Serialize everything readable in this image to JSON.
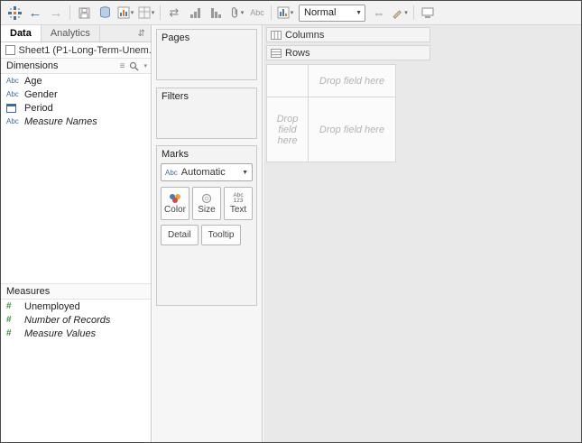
{
  "colors": {
    "dimension_blue": "#3d6a9e",
    "measure_green": "#3f8e3f",
    "accent_orange": "#e8762c",
    "toolbar_bg": "#f2f2f2",
    "canvas_bg": "#e9e9e9"
  },
  "icons": {
    "undo": "←",
    "redo": "→",
    "dropdown": "▾",
    "select_caret": "▼",
    "abc": "Abc",
    "numbers": "123",
    "hash": "#",
    "list": "≡",
    "pane_toggle": "⇵",
    "swap_axes": "⇄",
    "fit_width": "⇔"
  },
  "toolbar": {
    "fit_mode": "Normal"
  },
  "data_pane": {
    "tabs": [
      {
        "label": "Data"
      },
      {
        "label": "Analytics"
      }
    ],
    "data_source": "Sheet1 (P1-Long-Term-Unem...",
    "dimensions": {
      "header": "Dimensions",
      "items": [
        {
          "type": "string",
          "label": "Age",
          "italic": false
        },
        {
          "type": "string",
          "label": "Gender",
          "italic": false
        },
        {
          "type": "date",
          "label": "Period",
          "italic": false
        },
        {
          "type": "string",
          "label": "Measure Names",
          "italic": true
        }
      ]
    },
    "measures": {
      "header": "Measures",
      "items": [
        {
          "type": "number",
          "label": "Unemployed",
          "italic": false
        },
        {
          "type": "number",
          "label": "Number of Records",
          "italic": true
        },
        {
          "type": "number",
          "label": "Measure Values",
          "italic": true
        }
      ]
    }
  },
  "cards": {
    "pages_title": "Pages",
    "filters_title": "Filters",
    "marks": {
      "title": "Marks",
      "type_selector": "Automatic",
      "buttons": [
        "Color",
        "Size",
        "Text",
        "Detail",
        "Tooltip"
      ]
    }
  },
  "shelves": {
    "columns_label": "Columns",
    "rows_label": "Rows"
  },
  "canvas": {
    "drop_column": "Drop field here",
    "drop_row": "Drop field here",
    "drop_body": "Drop field here"
  }
}
